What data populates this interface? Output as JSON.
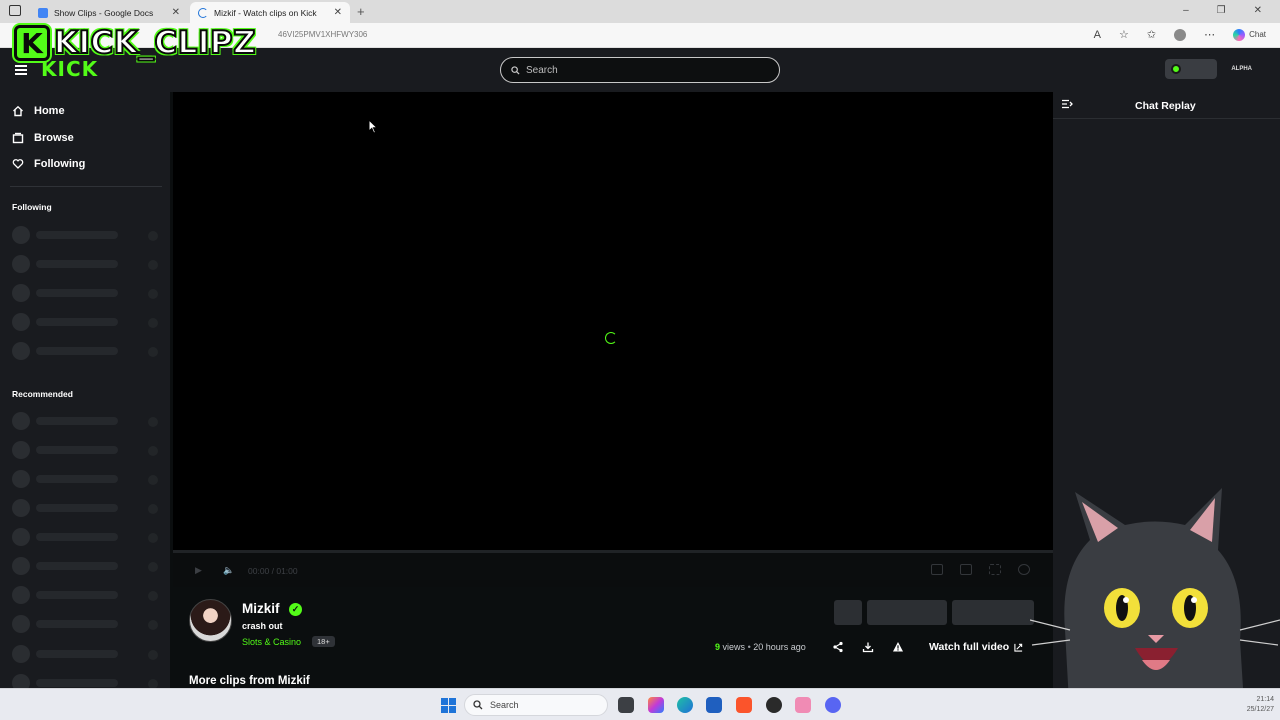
{
  "browser": {
    "tabs": [
      {
        "title": "Show Clips - Google Docs",
        "icon_color": "#4285f4"
      },
      {
        "title": "Mizkif - Watch clips on Kick",
        "icon_color": "#53fc18"
      }
    ],
    "new_tab_label": "+",
    "url": "46VI25PMV1XHFWY306",
    "chat_label": "Chat"
  },
  "overlay": {
    "logo_letter": "K",
    "logo_text": "KICK_CLIPZ"
  },
  "header": {
    "wordmark": "KICK",
    "search_placeholder": "Search",
    "brand_text": "ALPHA"
  },
  "sidebar": {
    "nav": [
      {
        "label": "Home",
        "icon": "home-icon"
      },
      {
        "label": "Browse",
        "icon": "browse-icon"
      },
      {
        "label": "Following",
        "icon": "heart-icon"
      }
    ],
    "following_heading": "Following",
    "recommended_heading": "Recommended"
  },
  "player": {
    "time": "00:00 / 01:00"
  },
  "clip": {
    "streamer": "Mizkif",
    "title": "crash out",
    "category": "Slots & Casino",
    "age_badge": "18+",
    "views_count": "9",
    "views_label": "views",
    "separator": "•",
    "posted": "20 hours ago",
    "watch_full_label": "Watch full video"
  },
  "more_clips_heading": "More clips from Mizkif",
  "chat": {
    "title": "Chat Replay"
  },
  "taskbar": {
    "search_label": "Search",
    "time": "21:14",
    "date": "25/12/27"
  },
  "colors": {
    "kick_green": "#53fc18",
    "background": "#0b0e0f",
    "panel": "#191b1f"
  }
}
